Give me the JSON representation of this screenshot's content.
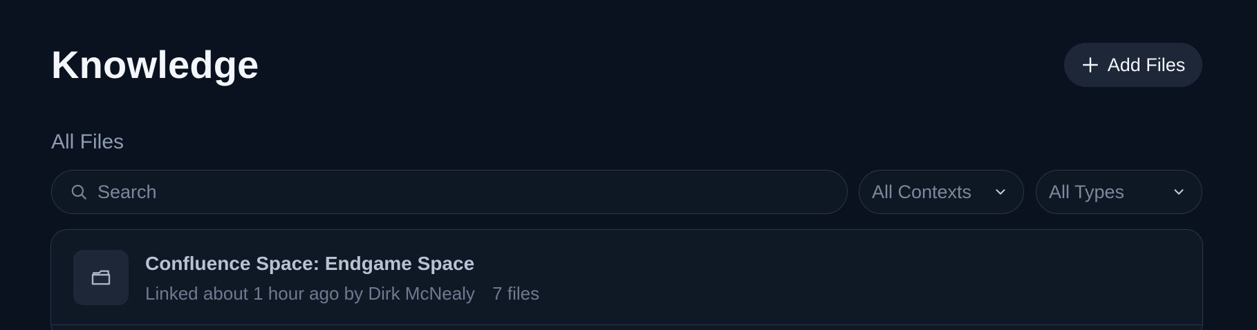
{
  "header": {
    "title": "Knowledge",
    "add_button_label": "Add Files"
  },
  "files": {
    "section_label": "All Files",
    "search_placeholder": "Search",
    "context_filter": "All Contexts",
    "type_filter": "All Types",
    "items": [
      {
        "title": "Confluence Space: Endgame Space",
        "meta": "Linked about 1 hour ago by Dirk McNealy",
        "count": "7 files",
        "icon": "folder-icon"
      }
    ]
  },
  "colors": {
    "background": "#0a1220",
    "surface": "#0f1825",
    "button": "#1d2738",
    "border": "#2b3648"
  }
}
